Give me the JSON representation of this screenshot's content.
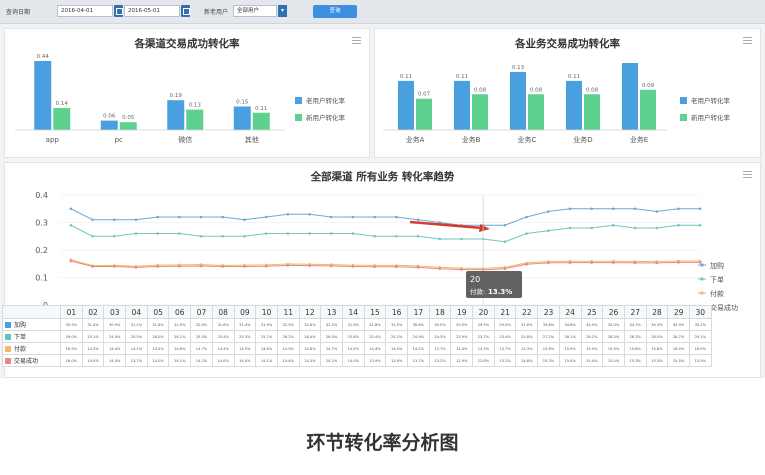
{
  "filter": {
    "date_label": "查询日期",
    "start_date": "2016-04-01",
    "end_date": "2016-05-01",
    "user_label": "新老用户",
    "user_value": "全部用户",
    "query_button": "查询"
  },
  "channel_chart": {
    "title": "各渠道交易成功转化率",
    "categories": [
      "app",
      "pc",
      "微信",
      "其他"
    ],
    "series": [
      {
        "name": "老用户转化率",
        "color": "#4a9fe0",
        "values": [
          0.44,
          0.06,
          0.19,
          0.15
        ]
      },
      {
        "name": "新用户转化率",
        "color": "#5fd18f",
        "values": [
          0.14,
          0.05,
          0.13,
          0.11
        ]
      }
    ],
    "value_labels": [
      [
        "0.44",
        "0.14"
      ],
      [
        "0.06",
        "0.05"
      ],
      [
        "0.19",
        "0.13"
      ],
      [
        "0.15",
        "0.11"
      ]
    ]
  },
  "business_chart": {
    "title": "各业务交易成功转化率",
    "categories": [
      "业务A",
      "业务B",
      "业务C",
      "业务D",
      "业务E"
    ],
    "series": [
      {
        "name": "老用户转化率",
        "color": "#4a9fe0",
        "values": [
          0.11,
          0.11,
          0.13,
          0.11,
          0.15
        ]
      },
      {
        "name": "新用户转化率",
        "color": "#5fd18f",
        "values": [
          0.07,
          0.08,
          0.08,
          0.08,
          0.09
        ]
      }
    ],
    "value_labels": [
      [
        "0.11",
        "0.07"
      ],
      [
        "0.11",
        "0.08"
      ],
      [
        "0.13",
        "0.08"
      ],
      [
        "0.11",
        "0.08"
      ],
      [
        "",
        "0.09"
      ]
    ]
  },
  "trend_chart": {
    "title": "全部渠道 所有业务 转化率趋势",
    "y_ticks": [
      "0",
      "0.1",
      "0.2",
      "0.3",
      "0.4"
    ],
    "ylim": [
      0,
      0.4
    ],
    "x": [
      "01",
      "02",
      "03",
      "04",
      "05",
      "06",
      "07",
      "08",
      "09",
      "10",
      "11",
      "12",
      "13",
      "14",
      "15",
      "16",
      "17",
      "18",
      "19",
      "20",
      "21",
      "22",
      "23",
      "24",
      "25",
      "26",
      "27",
      "28",
      "29",
      "30"
    ],
    "series": [
      {
        "name": "加购",
        "color": "#6da9d6",
        "values": [
          0.35,
          0.31,
          0.31,
          0.31,
          0.32,
          0.32,
          0.32,
          0.32,
          0.31,
          0.32,
          0.33,
          0.33,
          0.32,
          0.32,
          0.32,
          0.32,
          0.31,
          0.3,
          0.29,
          0.29,
          0.29,
          0.32,
          0.34,
          0.35,
          0.35,
          0.35,
          0.35,
          0.34,
          0.35,
          0.35
        ]
      },
      {
        "name": "下单",
        "color": "#6fc7c2",
        "values": [
          0.29,
          0.25,
          0.25,
          0.26,
          0.26,
          0.26,
          0.25,
          0.25,
          0.25,
          0.26,
          0.26,
          0.26,
          0.26,
          0.26,
          0.25,
          0.25,
          0.25,
          0.24,
          0.24,
          0.24,
          0.23,
          0.26,
          0.27,
          0.28,
          0.28,
          0.29,
          0.28,
          0.28,
          0.29,
          0.29
        ]
      },
      {
        "name": "付款",
        "color": "#f3b767",
        "values": [
          0.165,
          0.143,
          0.144,
          0.141,
          0.145,
          0.146,
          0.147,
          0.144,
          0.145,
          0.146,
          0.149,
          0.148,
          0.147,
          0.145,
          0.144,
          0.144,
          0.142,
          0.137,
          0.134,
          0.133,
          0.137,
          0.153,
          0.158,
          0.159,
          0.159,
          0.159,
          0.158,
          0.158,
          0.16,
          0.16
        ]
      },
      {
        "name": "交易成功",
        "color": "#e58a82",
        "values": [
          0.16,
          0.14,
          0.14,
          0.137,
          0.14,
          0.141,
          0.142,
          0.14,
          0.14,
          0.141,
          0.144,
          0.143,
          0.142,
          0.14,
          0.139,
          0.139,
          0.137,
          0.132,
          0.129,
          0.128,
          0.132,
          0.148,
          0.153,
          0.154,
          0.154,
          0.154,
          0.153,
          0.153,
          0.155,
          0.155
        ]
      }
    ],
    "tooltip": {
      "day": "20",
      "label": "付款:",
      "value": "13.3%"
    }
  },
  "table": {
    "rows": [
      {
        "label": "加购",
        "color": "#4a9fe0",
        "cells": [
          "35.5%",
          "31.0%",
          "30.9%",
          "31.2%",
          "31.8%",
          "31.9%",
          "32.0%",
          "31.6%",
          "31.4%",
          "31.9%",
          "32.5%",
          "32.6%",
          "32.2%",
          "31.9%",
          "31.8%",
          "31.5%",
          "30.8%",
          "30.0%",
          "29.5%",
          "29.3%",
          "29.0%",
          "31.6%",
          "33.6%",
          "34.8%",
          "34.9%",
          "35.0%",
          "34.7%",
          "34.3%",
          "34.9%",
          "35.2%"
        ]
      },
      {
        "label": "下单",
        "color": "#5fc4c0",
        "cells": [
          "29.0%",
          "25.1%",
          "24.9%",
          "25.5%",
          "26.0%",
          "26.1%",
          "25.3%",
          "25.4%",
          "25.3%",
          "25.7%",
          "26.2%",
          "26.4%",
          "26.0%",
          "25.8%",
          "25.4%",
          "25.2%",
          "24.9%",
          "24.3%",
          "23.9%",
          "23.7%",
          "23.4%",
          "25.8%",
          "27.2%",
          "28.1%",
          "28.2%",
          "28.5%",
          "28.3%",
          "28.0%",
          "28.7%",
          "29.1%"
        ]
      },
      {
        "label": "付款",
        "color": "#f3b767",
        "cells": [
          "16.5%",
          "14.3%",
          "14.4%",
          "14.1%",
          "14.5%",
          "14.6%",
          "14.7%",
          "14.4%",
          "14.5%",
          "14.6%",
          "14.9%",
          "14.8%",
          "14.7%",
          "14.5%",
          "14.4%",
          "14.4%",
          "14.2%",
          "13.7%",
          "13.4%",
          "13.3%",
          "13.7%",
          "15.3%",
          "15.8%",
          "15.9%",
          "15.9%",
          "15.9%",
          "15.8%",
          "15.8%",
          "16.0%",
          "16.0%"
        ]
      },
      {
        "label": "交易成功",
        "color": "#e58a82",
        "cells": [
          "16.0%",
          "14.0%",
          "14.0%",
          "13.7%",
          "14.0%",
          "14.1%",
          "14.2%",
          "14.0%",
          "14.0%",
          "14.1%",
          "14.4%",
          "14.3%",
          "14.2%",
          "14.0%",
          "13.9%",
          "13.9%",
          "13.7%",
          "13.2%",
          "12.9%",
          "12.8%",
          "13.2%",
          "14.8%",
          "15.3%",
          "15.4%",
          "15.4%",
          "15.4%",
          "15.3%",
          "15.3%",
          "15.5%",
          "15.5%"
        ]
      }
    ]
  },
  "caption": "环节转化率分析图"
}
